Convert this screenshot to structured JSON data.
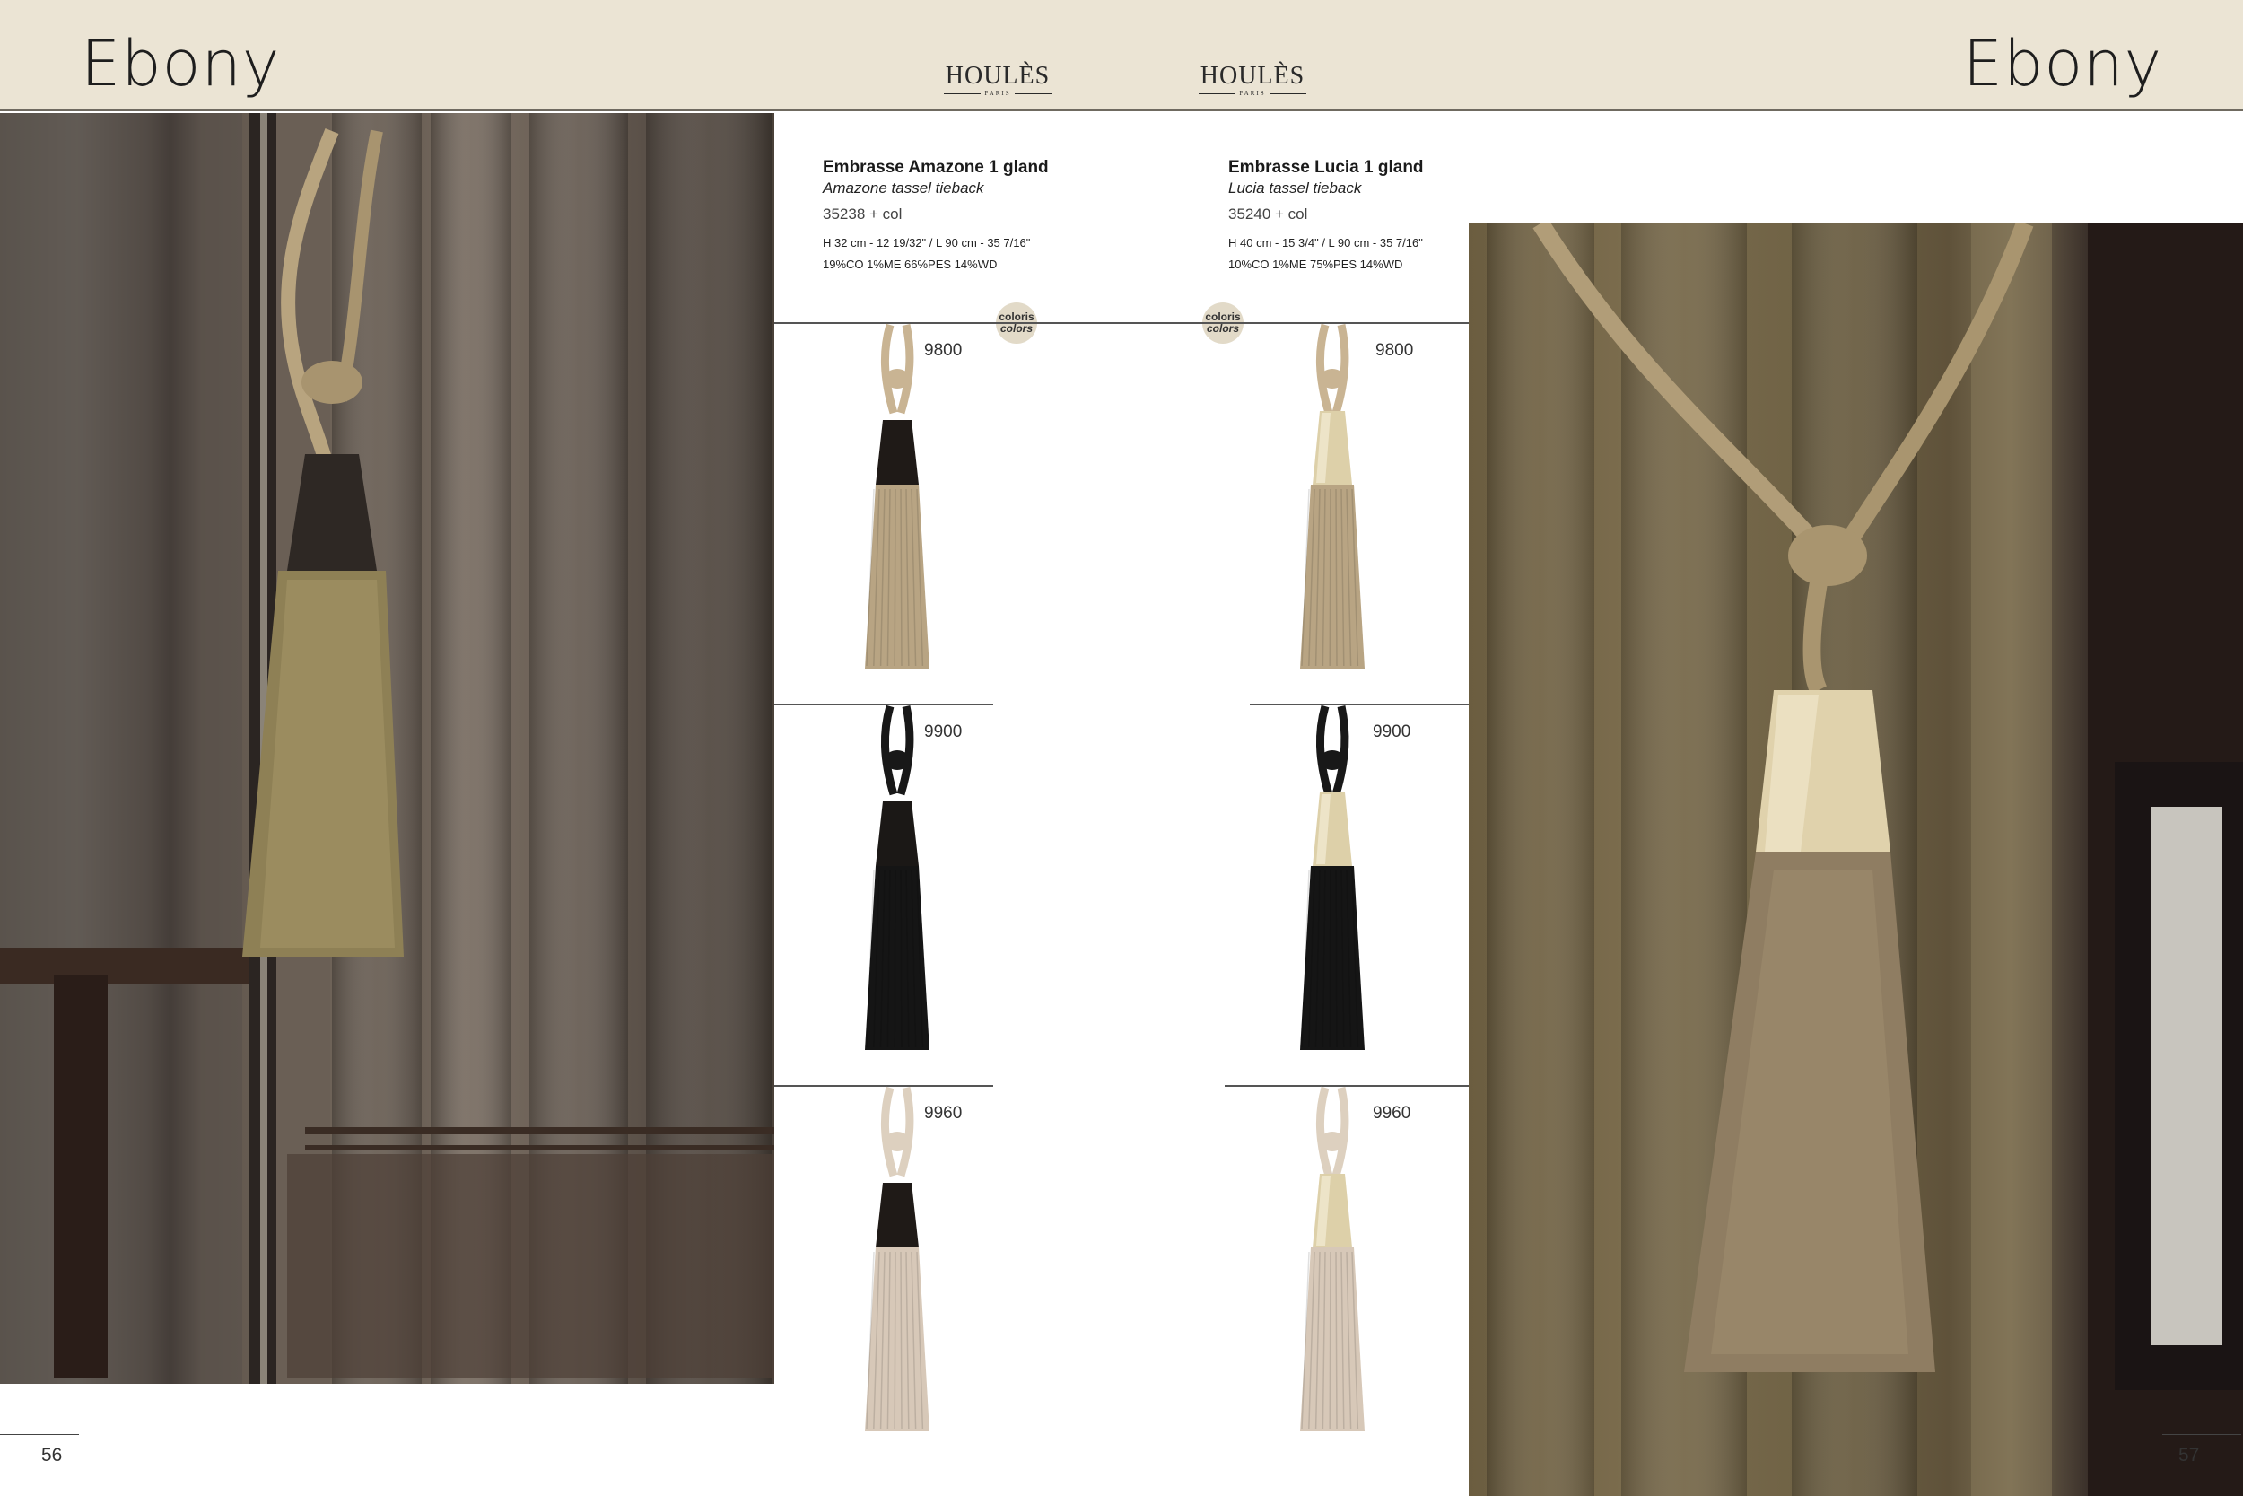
{
  "header": {
    "title_left": "Ebony",
    "title_right": "Ebony",
    "brand_name": "HOULÈS",
    "brand_sub": "PARIS"
  },
  "products": [
    {
      "title": "Embrasse Amazone 1 gland",
      "subtitle": "Amazone tassel tieback",
      "ref": "35238 + col",
      "dimensions": "H 32 cm - 12 19/32\" / L 90 cm - 35 7/16\"",
      "composition": "19%CO 1%ME 66%PES 14%WD",
      "badge_line1": "coloris",
      "badge_line2": "colors",
      "variants": [
        {
          "code": "9800",
          "cap": "#1f1a17",
          "fringe": "#b8a483",
          "cord": "#c9b493"
        },
        {
          "code": "9900",
          "cap": "#1b1816",
          "fringe": "#151515",
          "cord": "#181818"
        },
        {
          "code": "9960",
          "cap": "#1f1a17",
          "fringe": "#d7c8b8",
          "cord": "#ddd0bf"
        }
      ]
    },
    {
      "title": "Embrasse Lucia 1 gland",
      "subtitle": "Lucia tassel tieback",
      "ref": "35240 + col",
      "dimensions": "H 40 cm - 15 3/4\" / L 90 cm - 35 7/16\"",
      "composition": "10%CO 1%ME 75%PES 14%WD",
      "badge_line1": "coloris",
      "badge_line2": "colors",
      "variants": [
        {
          "code": "9800",
          "cap": "#ddd0a9",
          "fringe": "#b8a483",
          "cord": "#c9b493"
        },
        {
          "code": "9900",
          "cap": "#ddd0a9",
          "fringe": "#151515",
          "cord": "#181818"
        },
        {
          "code": "9960",
          "cap": "#ddd0a9",
          "fringe": "#d7c8b8",
          "cord": "#ddd0bf"
        }
      ]
    }
  ],
  "footer": {
    "page_left": "56",
    "page_right": "57"
  }
}
